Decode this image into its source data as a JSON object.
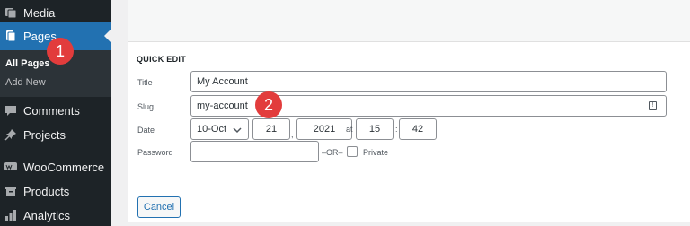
{
  "sidebar": {
    "items": [
      {
        "label": "Media",
        "icon": "media-icon"
      },
      {
        "label": "Pages",
        "icon": "pages-icon"
      },
      {
        "label": "Comments",
        "icon": "comments-icon"
      },
      {
        "label": "Projects",
        "icon": "pin-icon"
      },
      {
        "label": "WooCommerce",
        "icon": "woocommerce-icon"
      },
      {
        "label": "Products",
        "icon": "products-icon"
      },
      {
        "label": "Analytics",
        "icon": "analytics-icon"
      }
    ],
    "submenu": [
      {
        "label": "All Pages"
      },
      {
        "label": "Add New"
      }
    ]
  },
  "annotations": {
    "badge1": "1",
    "badge2": "2"
  },
  "quick_edit": {
    "heading": "QUICK EDIT",
    "title_label": "Title",
    "title_value": "My Account",
    "slug_label": "Slug",
    "slug_value": "my-account",
    "date_label": "Date",
    "month": "10-Oct",
    "day": "21",
    "year": "2021",
    "at": "at",
    "hour": "15",
    "minute": "42",
    "password_label": "Password",
    "password_value": "",
    "or_text": "–OR–",
    "private_label": "Private",
    "cancel": "Cancel"
  },
  "colors": {
    "accent": "#2271b1",
    "sidebar": "#1d2327",
    "badge": "#e23c3c"
  }
}
